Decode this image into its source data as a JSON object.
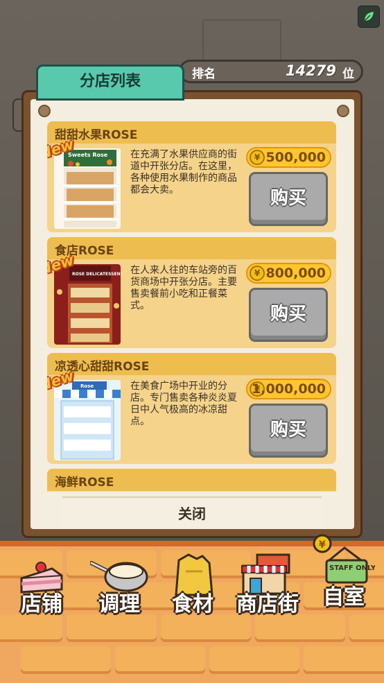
{
  "header": {
    "tab_title": "分店列表",
    "rank_label": "排名",
    "rank_value": "14279",
    "rank_unit": "位"
  },
  "branches": [
    {
      "name": "甜甜水果ROSE",
      "badge": "New",
      "thumb_sign": "Sweets Rose",
      "description": "在充满了水果供应商的街道中开张分店。在这里，各种使用水果制作的商品都会大卖。",
      "price": "500,000",
      "buy_label": "购买"
    },
    {
      "name": "食店ROSE",
      "badge": "New",
      "thumb_sign": "ROSE DELICATESSEN",
      "description": "在人来人往的车站旁的百货商场中开张分店。主要售卖餐前小吃和正餐菜式。",
      "price": "800,000",
      "buy_label": "购买"
    },
    {
      "name": "凉透心甜甜ROSE",
      "badge": "New",
      "thumb_sign": "Rose",
      "description": "在美食广场中开业的分店。专门售卖各种炎炎夏日中人气极高的冰凉甜点。",
      "price": "1,000,000",
      "buy_label": "购买"
    },
    {
      "name": "海鲜ROSE"
    }
  ],
  "coin_symbol": "¥",
  "close_label": "关闭",
  "bottom_nav": [
    {
      "label": "店铺",
      "icon": "cake-icon"
    },
    {
      "label": "调理",
      "icon": "mixing-bowl-icon"
    },
    {
      "label": "食材",
      "icon": "ingredients-bag-icon"
    },
    {
      "label": "商店街",
      "icon": "shop-street-icon"
    },
    {
      "label": "自室",
      "icon": "staff-room-icon",
      "sign": "STAFF ONLY"
    }
  ],
  "colors": {
    "tab": "#58c9ac",
    "item_header": "#eebd4f",
    "item_body": "#f5d38a",
    "price_pill": "#ffc62e",
    "buy_button": "#aaaaaa",
    "brick": "#f2b15a"
  }
}
